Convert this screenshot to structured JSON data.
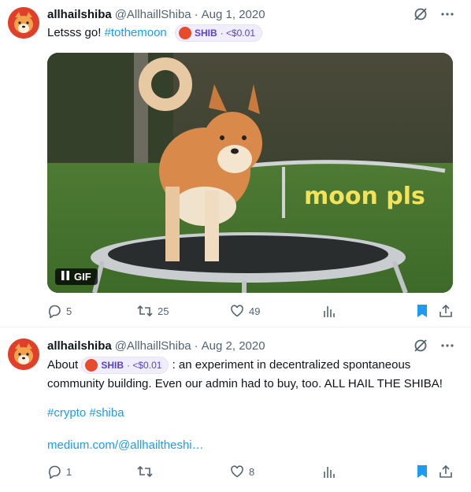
{
  "tweets": [
    {
      "author_name": "allhailshiba",
      "author_handle": "@AllhaillShiba",
      "separator": "·",
      "date": "Aug 1, 2020",
      "text_start": "Letsss go! ",
      "hashtag": "#tothemoon",
      "cashtag": {
        "symbol": "SHIB",
        "price": "· <$0.01"
      },
      "media": {
        "type": "gif",
        "caption": "moon pls",
        "badge": "GIF"
      },
      "stats": {
        "replies": "5",
        "retweets": "25",
        "likes": "49"
      }
    },
    {
      "author_name": "allhailshiba",
      "author_handle": "@AllhaillShiba",
      "separator": "·",
      "date": "Aug 2, 2020",
      "text_before": "About ",
      "cashtag": {
        "symbol": "SHIB",
        "price": "· <$0.01"
      },
      "text_after": " : an experiment in decentralized spontaneous community building. Even our admin had to buy, too. ALL HAIL THE SHIBA!",
      "hashtags": "#crypto #shiba",
      "link": "medium.com/@allhailtheshi…",
      "stats": {
        "replies": "1",
        "retweets": "",
        "likes": "8"
      }
    }
  ],
  "icons": {
    "grok": "grok-slash-icon",
    "more": "more-dots-icon",
    "reply": "reply-icon",
    "retweet": "retweet-icon",
    "like": "heart-icon",
    "views": "views-chart-icon",
    "bookmark": "bookmark-icon",
    "share": "share-icon"
  },
  "colors": {
    "accent": "#1d9bf0",
    "muted": "#536471",
    "bookmark": "#1d9bf0",
    "cashtag": "#5b3fd6"
  }
}
